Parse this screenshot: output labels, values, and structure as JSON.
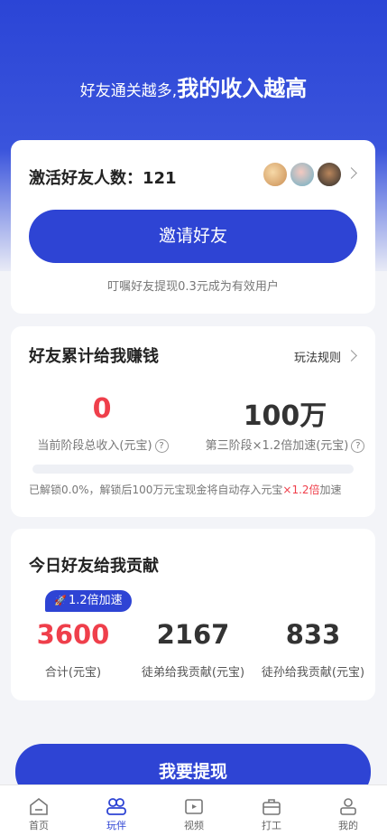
{
  "hero": {
    "title_small": "好友通关越多,",
    "title_big": "我的收入越高"
  },
  "invite_card": {
    "title": "激活好友人数：121",
    "invite_button": "邀请好友",
    "note": "叮嘱好友提现0.3元成为有效用户"
  },
  "earn_card": {
    "title": "好友累计给我赚钱",
    "rules_link": "玩法规则",
    "current_value": "0",
    "current_label": "当前阶段总收入(元宝)",
    "target_value": "100万",
    "target_label": "第三阶段×1.2倍加速(元宝)",
    "progress_percent": 0.0,
    "note_prefix": "已解锁0.0%，解锁后100万元宝现金将自动存入元宝",
    "note_highlight": "×1.2倍",
    "note_suffix": "加速"
  },
  "today_card": {
    "title": "今日好友给我贡献",
    "boost_badge": "1.2倍加速",
    "total_value": "3600",
    "total_label": "合计(元宝)",
    "disciple_value": "2167",
    "disciple_label": "徒弟给我贡献(元宝)",
    "grand_value": "833",
    "grand_label": "徒孙给我贡献(元宝)"
  },
  "withdraw_button": "我要提现",
  "tabbar": {
    "items": [
      {
        "label": "首页",
        "icon": "home-icon",
        "active": false
      },
      {
        "label": "玩伴",
        "icon": "friends-icon",
        "active": true
      },
      {
        "label": "视频",
        "icon": "video-icon",
        "active": false
      },
      {
        "label": "打工",
        "icon": "briefcase-icon",
        "active": false
      },
      {
        "label": "我的",
        "icon": "profile-icon",
        "active": false
      }
    ]
  },
  "colors": {
    "primary": "#2e44d4",
    "accent_red": "#ef3f4b",
    "background": "#f3f4f8"
  }
}
